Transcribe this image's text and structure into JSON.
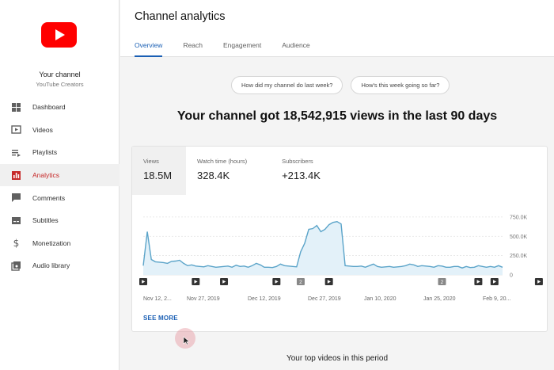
{
  "sidebar": {
    "channel_name": "Your channel",
    "channel_subtitle": "YouTube Creators",
    "logo_icon": "youtube-logo",
    "items": [
      {
        "label": "Dashboard",
        "icon": "dashboard-icon",
        "active": false
      },
      {
        "label": "Videos",
        "icon": "videos-icon",
        "active": false
      },
      {
        "label": "Playlists",
        "icon": "playlists-icon",
        "active": false
      },
      {
        "label": "Analytics",
        "icon": "analytics-icon",
        "active": true
      },
      {
        "label": "Comments",
        "icon": "comments-icon",
        "active": false
      },
      {
        "label": "Subtitles",
        "icon": "subtitles-icon",
        "active": false
      },
      {
        "label": "Monetization",
        "icon": "monetization-icon",
        "active": false
      },
      {
        "label": "Audio library",
        "icon": "audio-library-icon",
        "active": false
      }
    ]
  },
  "header": {
    "title": "Channel analytics",
    "tabs": [
      {
        "label": "Overview",
        "active": true
      },
      {
        "label": "Reach",
        "active": false
      },
      {
        "label": "Engagement",
        "active": false
      },
      {
        "label": "Audience",
        "active": false
      }
    ]
  },
  "chips": [
    "How did my channel do last week?",
    "How's this week going so far?"
  ],
  "headline": "Your channel got 18,542,915 views in the last 90 days",
  "metrics": [
    {
      "label": "Views",
      "value": "18.5M",
      "active": true
    },
    {
      "label": "Watch time (hours)",
      "value": "328.4K",
      "active": false
    },
    {
      "label": "Subscribers",
      "value": "+213.4K",
      "active": false
    }
  ],
  "see_more": "SEE MORE",
  "top_videos_title": "Your top videos in this period",
  "colors": {
    "accent": "#1a5fb4",
    "active_nav": "#c62828",
    "brand_red": "#ff0000",
    "series_line": "#5ba4c9",
    "series_fill": "#e3f1f9"
  },
  "chart_data": {
    "type": "area",
    "series": [
      {
        "values": [
          120,
          560,
          200,
          170,
          165,
          160,
          150,
          175,
          180,
          190,
          150,
          120,
          130,
          115,
          110,
          105,
          120,
          110,
          100,
          105,
          110,
          115,
          100,
          125,
          110,
          115,
          100,
          120,
          150,
          130,
          100,
          100,
          95,
          110,
          140,
          120,
          115,
          110,
          105,
          300,
          410,
          590,
          600,
          640,
          560,
          590,
          650,
          680,
          690,
          660,
          120,
          115,
          110,
          110,
          115,
          100,
          120,
          140,
          110,
          100,
          105,
          110,
          100,
          105,
          110,
          120,
          140,
          130,
          110,
          120,
          115,
          110,
          100,
          120,
          115,
          100,
          100,
          110,
          110,
          90,
          110,
          95,
          100,
          120,
          110,
          100,
          110,
          100,
          120,
          100
        ]
      }
    ],
    "x_tick_labels": [
      "Nov 12, 2...",
      "Nov 27, 2019",
      "Dec 12, 2019",
      "Dec 27, 2019",
      "Jan 10, 2020",
      "Jan 25, 2020",
      "Feb 9, 20..."
    ],
    "y_tick_labels": [
      "750.0K",
      "500.0K",
      "250.0K",
      "0"
    ],
    "y_ticks": [
      750,
      500,
      250,
      0
    ],
    "ylim": [
      0,
      800
    ],
    "y_unit": "K",
    "markers": [
      {
        "index": 0,
        "type": "play"
      },
      {
        "index": 13,
        "type": "play"
      },
      {
        "index": 20,
        "type": "play"
      },
      {
        "index": 33,
        "type": "play"
      },
      {
        "index": 39,
        "type": "count",
        "label": "2"
      },
      {
        "index": 46,
        "type": "play"
      },
      {
        "index": 74,
        "type": "count",
        "label": "2"
      },
      {
        "index": 83,
        "type": "play"
      },
      {
        "index": 87,
        "type": "play"
      },
      {
        "index": 98,
        "type": "play"
      }
    ],
    "grid": "horizontal dashed"
  }
}
